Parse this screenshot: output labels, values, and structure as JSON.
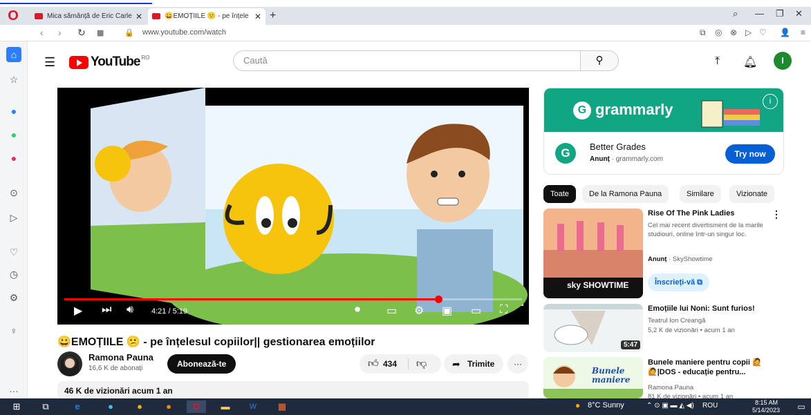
{
  "browser": {
    "tabs": [
      {
        "label": "Mica sămânță de Eric Carle",
        "active": false
      },
      {
        "label": "😀EMOȚIILE 😕 - pe înțele",
        "active": true
      }
    ],
    "url": "www.youtube.com/watch"
  },
  "youtube": {
    "logo_text": "YouTube",
    "country": "RO",
    "search_placeholder": "Caută",
    "avatar_letter": "I"
  },
  "video": {
    "time": "4:21 / 5:19",
    "progress": 0.817,
    "title": "😀EMOȚIILE 😕 - pe înțelesul copiilor|| gestionarea emoțiilor",
    "channel": "Ramona Pauna",
    "subscribers": "16,6 K de abonați",
    "subscribe_label": "Abonează-te",
    "likes": "434",
    "share_label": "Trimite",
    "views_line": "46 K de vizionări  acum 1 an"
  },
  "ad": {
    "brand": "grammarly",
    "headline": "Better Grades",
    "tag": "Anunț",
    "domain": "grammarly.com",
    "cta": "Try now"
  },
  "chips": [
    "Toate",
    "De la Ramona Pauna",
    "Similare",
    "Vizionate"
  ],
  "recommendations": [
    {
      "title": "Rise Of The Pink Ladies",
      "meta1": "Cel mai recent divertisment de la marile studiouri, online într-un singur loc.",
      "tag": "Anunț",
      "sponsor": "SkyShowtime",
      "cta": "Înscrieți-vă",
      "thumb_text": "sky SHOWTIME"
    },
    {
      "title": "Emoțiile lui Noni: Sunt furios!",
      "meta1": "Teatrul Ion Creangă",
      "meta2": "5,2 K de vizionări  • acum 1 an",
      "duration": "5:47"
    },
    {
      "title": "Bunele maniere pentru copii 🙋 🙋|DOS - educație pentru...",
      "meta1": "Ramona Pauna",
      "meta2": "81 K de vizionări  • acum 1 an",
      "thumb_text": "Bunele maniere"
    }
  ],
  "taskbar": {
    "weather": "8°C  Sunny",
    "lang": "ROU",
    "time": "8:15 AM",
    "date": "5/14/2023"
  },
  "colors": {
    "youtube_red": "#ff0000",
    "grammarly_green": "#11a683",
    "cta_blue": "#065fd4",
    "taskbar": "#1f2b3d"
  }
}
